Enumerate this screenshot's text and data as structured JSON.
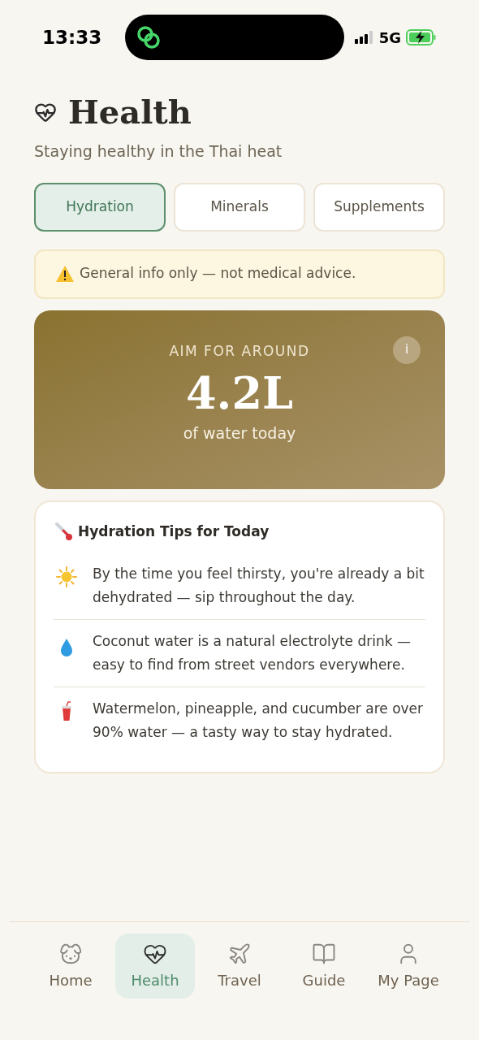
{
  "status_bar": {
    "time": "13:33",
    "network": "5G"
  },
  "header": {
    "title": "Health",
    "subtitle": "Staying healthy in the Thai heat"
  },
  "tabs": [
    {
      "label": "Hydration",
      "selected": true
    },
    {
      "label": "Minerals",
      "selected": false
    },
    {
      "label": "Supplements",
      "selected": false
    }
  ],
  "notice": "General info only — not medical advice.",
  "goal": {
    "label": "AIM FOR AROUND",
    "info": "i",
    "amount": "4.2L",
    "caption": "of water today"
  },
  "tips": {
    "title": "Hydration Tips for Today",
    "items": [
      {
        "kind": "sun",
        "text": "By the time you feel thirsty, you're already a bit dehydrated — sip throughout the day."
      },
      {
        "kind": "drop",
        "text": "Coconut water is a natural electrolyte drink — easy to find from street vendors everywhere."
      },
      {
        "kind": "cup",
        "text": "Watermelon, pineapple, and cucumber are over 90% water — a tasty way to stay hydrated."
      }
    ]
  },
  "nav": [
    {
      "kind": "dog",
      "label": "Home",
      "selected": false
    },
    {
      "kind": "heart",
      "label": "Health",
      "selected": true
    },
    {
      "kind": "plane",
      "label": "Travel",
      "selected": false
    },
    {
      "kind": "book",
      "label": "Guide",
      "selected": false
    },
    {
      "kind": "user",
      "label": "My Page",
      "selected": false
    }
  ]
}
